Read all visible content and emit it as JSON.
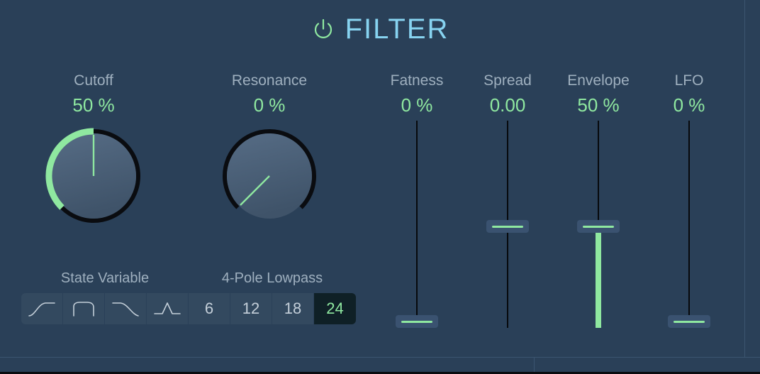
{
  "header": {
    "title": "FILTER",
    "power_icon": "power-icon",
    "title_color": "#87d3f0",
    "power_color": "#8fe8a0"
  },
  "theme": {
    "background": "#2a4058",
    "label_color": "#9fb0bf",
    "value_color": "#8fe8a0",
    "accent_green": "#8fe8a0",
    "accent_blue": "#87d3f0",
    "knob_face": "#4c6179",
    "selected_bg": "#0f2026",
    "button_bg": "#33495f",
    "divider": "#3b5570"
  },
  "knobs": [
    {
      "name": "cutoff",
      "label": "Cutoff",
      "value": "50 %",
      "percent": 50
    },
    {
      "name": "resonance",
      "label": "Resonance",
      "value": "0 %",
      "percent": 0
    }
  ],
  "sliders": [
    {
      "name": "fatness",
      "label": "Fatness",
      "value": "0 %",
      "percent": 0
    },
    {
      "name": "spread",
      "label": "Spread",
      "value": "0.00",
      "percent": 50
    },
    {
      "name": "envelope",
      "label": "Envelope",
      "value": "50 %",
      "percent": 50
    },
    {
      "name": "lfo",
      "label": "LFO",
      "value": "0 %",
      "percent": 0
    }
  ],
  "filter_mode": {
    "group_label": "State Variable",
    "options": [
      {
        "name": "highpass",
        "icon": "highpass-curve-icon",
        "selected": false
      },
      {
        "name": "bandpass",
        "icon": "bandpass-curve-icon",
        "selected": false
      },
      {
        "name": "lowpass",
        "icon": "lowpass-curve-icon",
        "selected": false
      },
      {
        "name": "peak",
        "icon": "peak-curve-icon",
        "selected": false
      }
    ]
  },
  "filter_slope": {
    "group_label": "4-Pole Lowpass",
    "options": [
      {
        "name": "6",
        "label": "6",
        "selected": false
      },
      {
        "name": "12",
        "label": "12",
        "selected": false
      },
      {
        "name": "18",
        "label": "18",
        "selected": false
      },
      {
        "name": "24",
        "label": "24",
        "selected": true
      }
    ]
  }
}
